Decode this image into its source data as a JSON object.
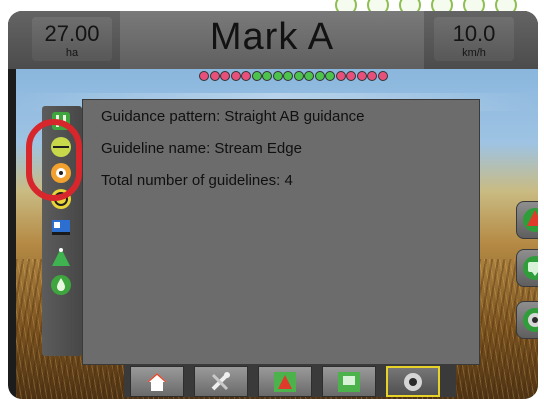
{
  "header": {
    "area": {
      "value": "27.00",
      "unit": "ha"
    },
    "title": "Mark A",
    "speed": {
      "value": "10.0",
      "unit": "km/h"
    }
  },
  "info_panel": {
    "lines": [
      "Guidance pattern: Straight AB guidance",
      "Guideline name: Stream Edge",
      "Total number of guidelines: 4"
    ]
  },
  "left_toolbar": {
    "icons": [
      "field-marker-icon",
      "ab-line-icon",
      "target-icon",
      "steering-icon",
      "implement-icon",
      "vehicle-icon",
      "water-drop-icon"
    ]
  },
  "right_toolbar": {
    "icons": [
      "nav-arrow-icon",
      "chat-icon",
      "camera-view-icon"
    ]
  },
  "lightbar": {
    "leds": [
      "pink",
      "pink",
      "pink",
      "pink",
      "pink",
      "green",
      "green",
      "green",
      "green",
      "green",
      "green",
      "green",
      "green",
      "pink",
      "pink",
      "pink",
      "pink",
      "pink"
    ],
    "colors": {
      "pink": "#e6507a",
      "green": "#4cc34c"
    }
  },
  "bottom_nav": {
    "items": [
      "home-icon",
      "tools-icon",
      "guidance-icon",
      "mapping-icon",
      "camera-icon"
    ],
    "active_index": 4
  },
  "colors": {
    "accent_green": "#3fa63f",
    "callout_red": "#d7262c",
    "active_yellow": "#e7d22a"
  }
}
